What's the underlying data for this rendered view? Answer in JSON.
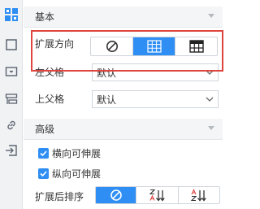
{
  "sidebar": {
    "items": [
      {
        "icon": "cell-expand-icon",
        "active": true
      },
      {
        "icon": "square-frame-icon",
        "active": false
      },
      {
        "icon": "widget-icon",
        "active": false
      },
      {
        "icon": "layers-icon",
        "active": false
      },
      {
        "icon": "link-icon",
        "active": false
      },
      {
        "icon": "import-icon",
        "active": false
      }
    ]
  },
  "basic": {
    "title": "基本",
    "expand_direction": {
      "label": "扩展方向",
      "options": [
        "none",
        "vertical",
        "horizontal"
      ],
      "selected": "vertical"
    },
    "left_parent": {
      "label": "左父格",
      "value": "默认"
    },
    "top_parent": {
      "label": "上父格",
      "value": "默认"
    }
  },
  "advanced": {
    "title": "高级",
    "horizontal_stretch": {
      "label": "横向可伸展",
      "checked": true
    },
    "vertical_stretch": {
      "label": "纵向可伸展",
      "checked": true
    },
    "sort_after_expand": {
      "label": "扩展后排序",
      "options": [
        "none",
        "ascending",
        "descending"
      ],
      "selected": "none"
    }
  },
  "colors": {
    "accent": "#2f8ef4",
    "highlight_border": "#e0443e",
    "sidebar_bg": "#f1f2f4",
    "header_bg": "#f4f5f7"
  }
}
